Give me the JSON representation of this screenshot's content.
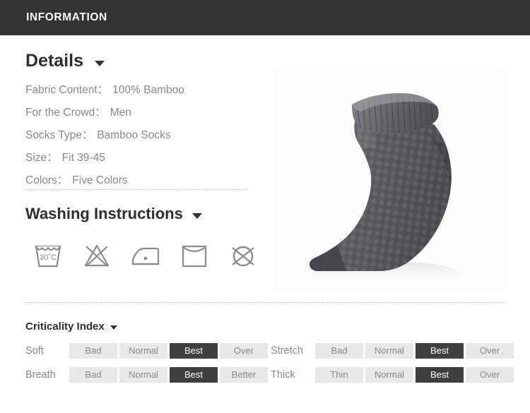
{
  "header": {
    "title": "INFORMATION",
    "background_color": "#333333",
    "text_color": "#ffffff"
  },
  "details": {
    "heading": "Details",
    "caret_icon": "chevron-down-icon",
    "rows": [
      {
        "label": "Fabric Content：",
        "value": "100% Bamboo"
      },
      {
        "label": "For the Crowd：",
        "value": "Men"
      },
      {
        "label": "Socks Type：",
        "value": "Bamboo Socks"
      },
      {
        "label": "Size：",
        "value": "Fit 39-45"
      },
      {
        "label": "Colors：",
        "value": "Five Colors"
      }
    ]
  },
  "washing": {
    "heading": "Washing Instructions",
    "caret_icon": "chevron-down-icon",
    "icons": [
      {
        "name": "wash-30-degrees-icon",
        "label": "30°C",
        "description": "Machine wash at 30 degrees Celsius"
      },
      {
        "name": "do-not-bleach-icon",
        "label": "",
        "description": "Do not bleach"
      },
      {
        "name": "iron-low-heat-icon",
        "label": "",
        "description": "Iron low heat, one dot"
      },
      {
        "name": "line-dry-icon",
        "label": "",
        "description": "Line dry"
      },
      {
        "name": "do-not-dry-clean-icon",
        "label": "",
        "description": "Do not dry clean"
      }
    ]
  },
  "criticality": {
    "heading": "Criticality Index",
    "caret_icon": "chevron-down-icon",
    "left_rows": [
      {
        "label": "Soft",
        "options": [
          "Bad",
          "Normal",
          "Best",
          "Over"
        ],
        "selected": "Best"
      },
      {
        "label": "Breath",
        "options": [
          "Bad",
          "Normal",
          "Best",
          "Better"
        ],
        "selected": "Best"
      }
    ],
    "right_rows": [
      {
        "label": "Stretch",
        "options": [
          "Bad",
          "Normal",
          "Best",
          "Over"
        ],
        "selected": "Best"
      },
      {
        "label": "Thick",
        "options": [
          "Thin",
          "Normal",
          "Best",
          "Over"
        ],
        "selected": "Best"
      }
    ],
    "selected_color": "#3f3f3f",
    "pill_color": "#e8e8e8"
  },
  "product_image": {
    "alt": "Dark gray bamboo ankle sock with checkered knit texture on white background"
  }
}
